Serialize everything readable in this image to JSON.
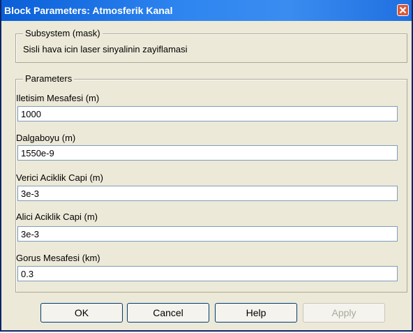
{
  "window": {
    "title": "Block Parameters: Atmosferik Kanal"
  },
  "mask": {
    "legend": "Subsystem (mask)",
    "description": "Sisli hava icin laser sinyalinin zayiflamasi"
  },
  "parameters": {
    "legend": "Parameters",
    "fields": [
      {
        "label": "Iletisim Mesafesi (m)",
        "value": "1000"
      },
      {
        "label": "Dalgaboyu (m)",
        "value": "1550e-9"
      },
      {
        "label": "Verici Aciklik Capi (m)",
        "value": "3e-3"
      },
      {
        "label": "Alici Aciklik Capi (m)",
        "value": "3e-3"
      },
      {
        "label": "Gorus Mesafesi (km)",
        "value": "0.3"
      }
    ]
  },
  "buttons": {
    "ok": "OK",
    "cancel": "Cancel",
    "help": "Help",
    "apply": "Apply"
  },
  "icons": {
    "close": "close-icon"
  },
  "colors": {
    "titlebar": "#2f86f0",
    "dialog_bg": "#ece9d8",
    "close_button": "#d85a3a"
  }
}
